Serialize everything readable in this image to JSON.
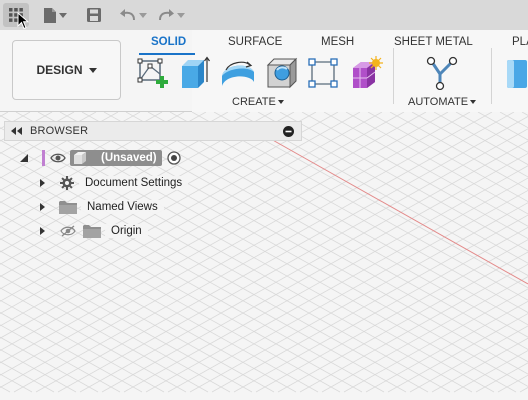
{
  "workspace": {
    "label": "DESIGN"
  },
  "tabs": [
    {
      "label": "SOLID",
      "active": true
    },
    {
      "label": "SURFACE",
      "active": false
    },
    {
      "label": "MESH",
      "active": false
    },
    {
      "label": "SHEET METAL",
      "active": false
    },
    {
      "label": "PLA",
      "active": false
    }
  ],
  "groups": {
    "create": {
      "label": "CREATE"
    },
    "automate": {
      "label": "AUTOMATE"
    }
  },
  "tools": [
    {
      "icon": "create-sketch-icon"
    },
    {
      "icon": "extrude-icon"
    },
    {
      "icon": "revolve-icon"
    },
    {
      "icon": "hole-icon"
    },
    {
      "icon": "sketch-pattern-icon"
    },
    {
      "icon": "form-icon"
    },
    {
      "icon": "automate-icon"
    },
    {
      "icon": "plastic-icon"
    }
  ],
  "browser": {
    "title": "BROWSER",
    "root": {
      "label": "(Unsaved)",
      "accent_color": "#c07fd1"
    },
    "items": [
      {
        "label": "Document Settings",
        "icon": "gear-icon"
      },
      {
        "label": "Named Views",
        "icon": "folder-icon"
      },
      {
        "label": "Origin",
        "icon": "folder-icon",
        "hidden": true
      }
    ]
  },
  "colors": {
    "accent": "#1973c8",
    "highlight_axis": "#e38a8a",
    "grid": "#d9d9d9"
  }
}
